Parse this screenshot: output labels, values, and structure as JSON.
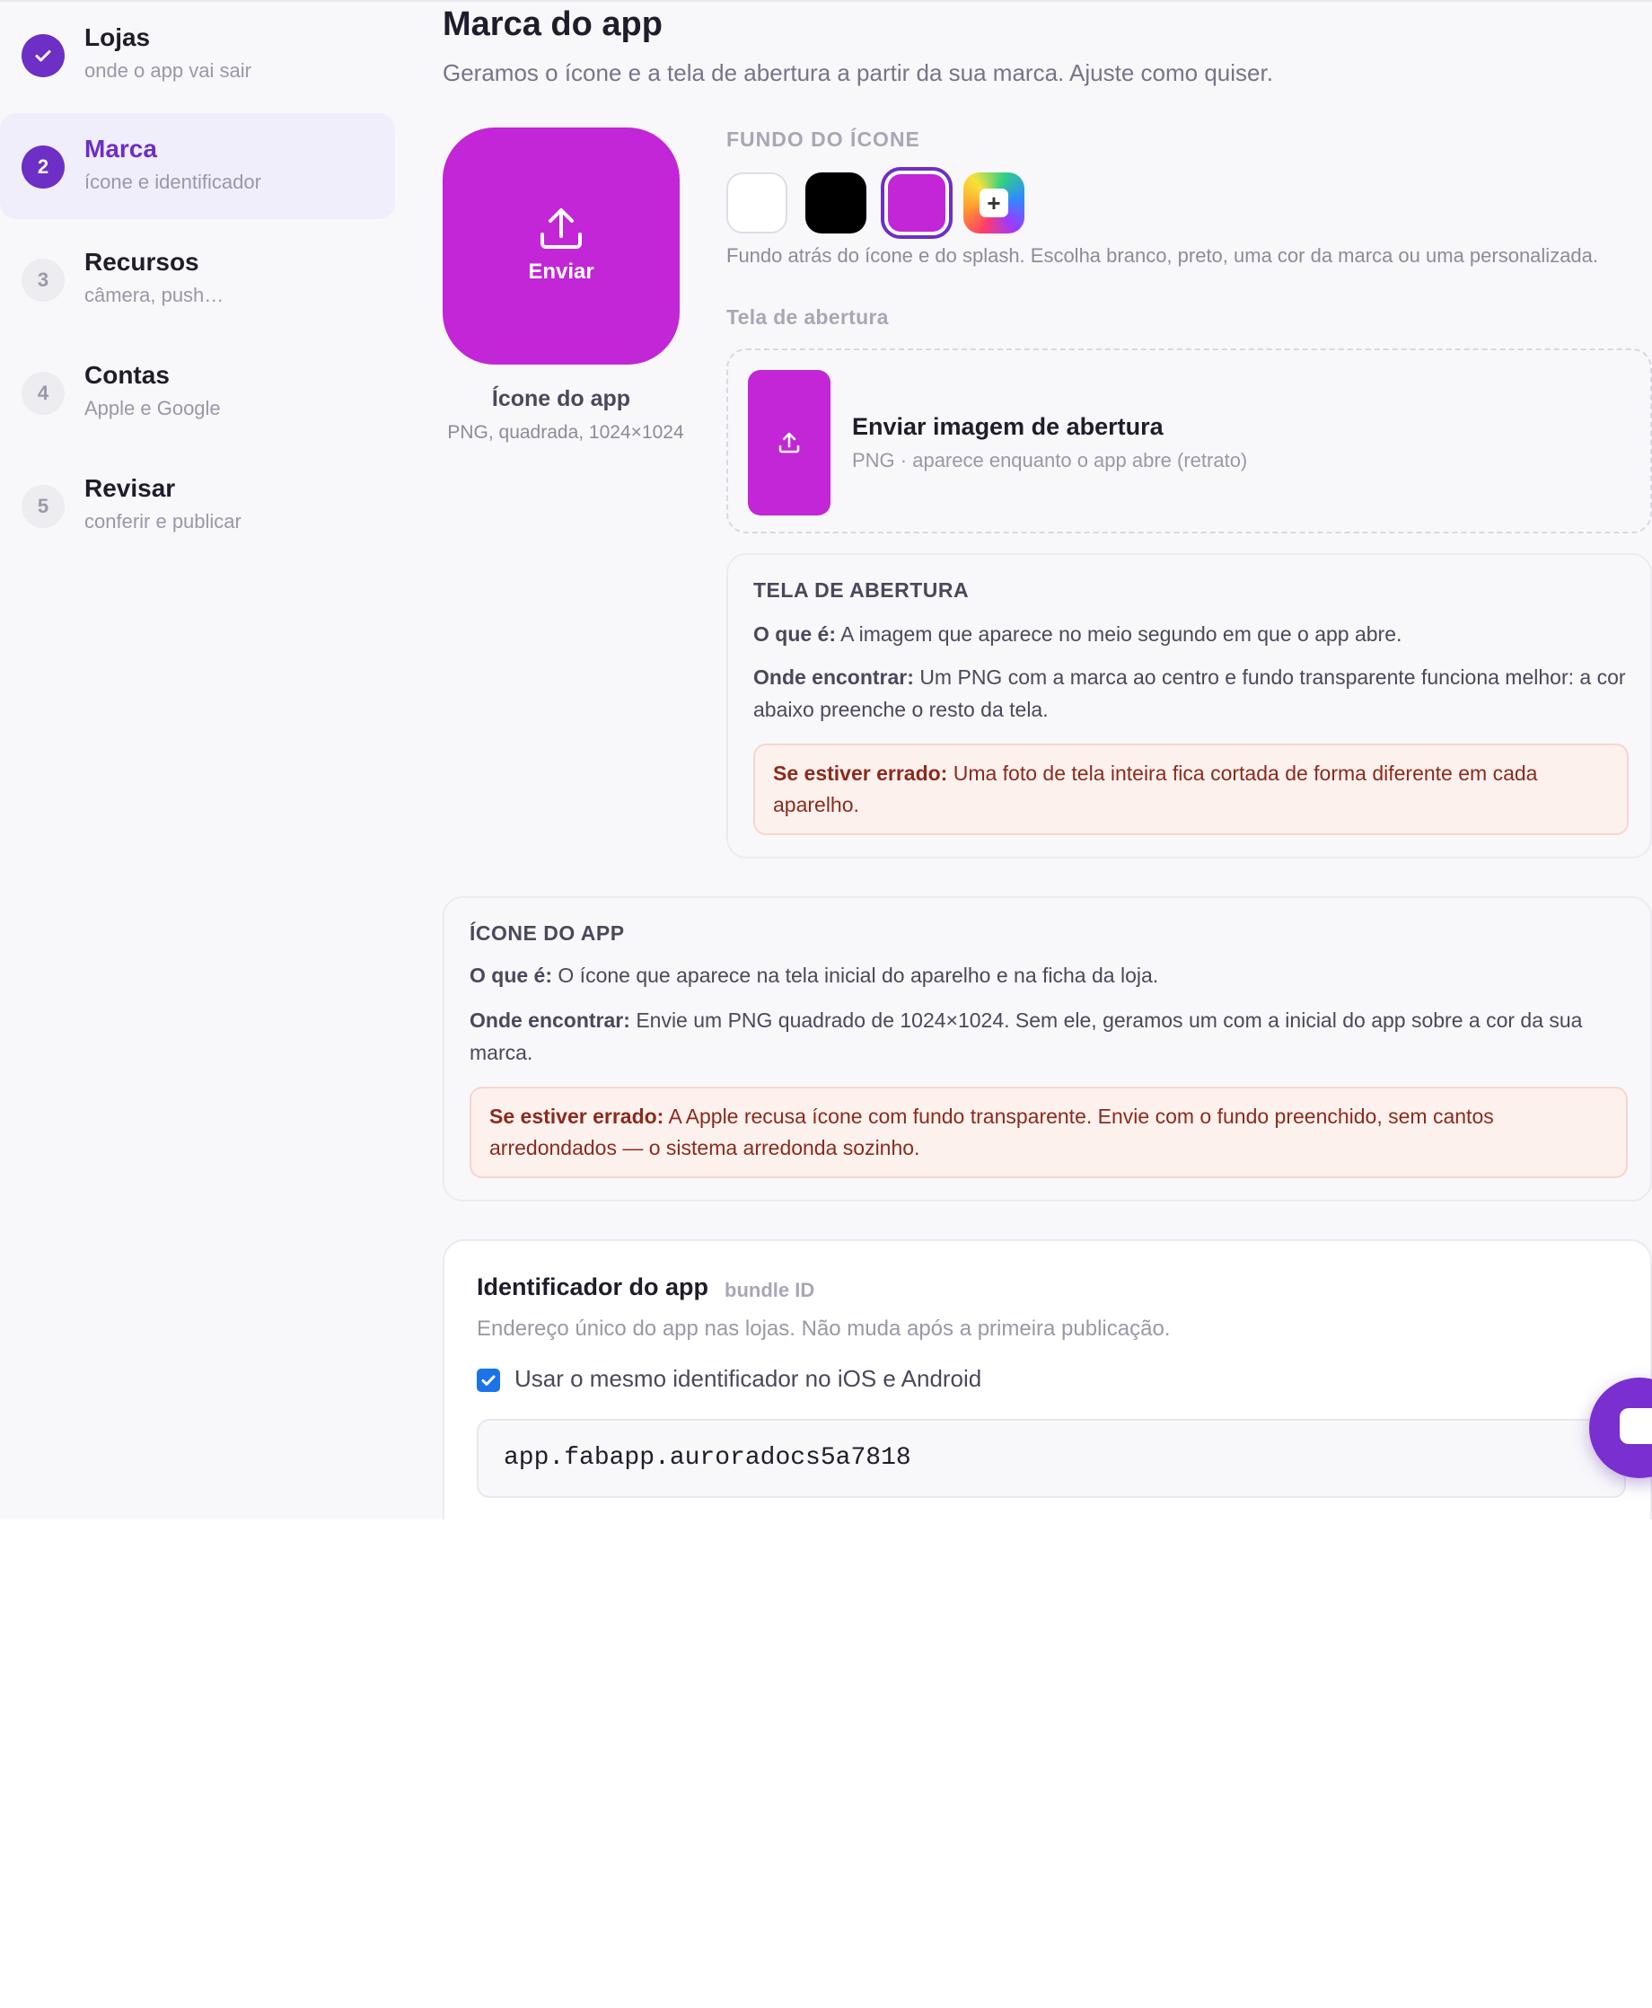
{
  "sidebar": {
    "steps": [
      {
        "number": "",
        "title": "Lojas",
        "subtitle": "onde o app vai sair",
        "state": "done"
      },
      {
        "number": "2",
        "title": "Marca",
        "subtitle": "ícone e identificador",
        "state": "current"
      },
      {
        "number": "3",
        "title": "Recursos",
        "subtitle": "câmera, push…",
        "state": "pending"
      },
      {
        "number": "4",
        "title": "Contas",
        "subtitle": "Apple e Google",
        "state": "pending"
      },
      {
        "number": "5",
        "title": "Revisar",
        "subtitle": "conferir e publicar",
        "state": "pending"
      }
    ]
  },
  "main": {
    "title": "Marca do app",
    "subtitle": "Geramos o ícone e a tela de abertura a partir da sua marca. Ajuste como quiser.",
    "icon_upload": {
      "button_label": "Enviar",
      "caption_title": "Ícone do app",
      "caption_sub": "PNG, quadrada, 1024×1024"
    },
    "icon_background": {
      "label": "FUNDO DO ÍCONE",
      "swatches": [
        {
          "name": "white",
          "color": "#ffffff"
        },
        {
          "name": "black",
          "color": "#000000"
        },
        {
          "name": "brand",
          "color": "#c226d6",
          "selected": true
        },
        {
          "name": "custom",
          "icon": "plus-icon"
        }
      ],
      "help": "Fundo atrás do ícone e do splash. Escolha branco, preto, uma cor da marca ou uma personalizada."
    },
    "splash": {
      "label": "Tela de abertura",
      "upload_title": "Enviar imagem de abertura",
      "upload_sub": "PNG · aparece enquanto o app abre (retrato)"
    },
    "splash_info": {
      "title": "TELA DE ABERTURA",
      "what_label": "O que é:",
      "what_text": "A imagem que aparece no meio segundo em que o app abre.",
      "where_label": "Onde encontrar:",
      "where_text": "Um PNG com a marca ao centro e fundo transparente funciona melhor: a cor abaixo preenche o resto da tela.",
      "wrong_label": "Se estiver errado:",
      "wrong_text": "Uma foto de tela inteira fica cortada de forma diferente em cada aparelho."
    },
    "icon_info": {
      "title": "ÍCONE DO APP",
      "what_label": "O que é:",
      "what_text": "O ícone que aparece na tela inicial do aparelho e na ficha da loja.",
      "where_label": "Onde encontrar:",
      "where_text": "Envie um PNG quadrado de 1024×1024. Sem ele, geramos um com a inicial do app sobre a cor da sua marca.",
      "wrong_label": "Se estiver errado:",
      "wrong_text": "A Apple recusa ícone com fundo transparente. Envie com o fundo preenchido, sem cantos arredondados — o sistema arredonda sozinho."
    },
    "identifier": {
      "title": "Identificador do app",
      "tag": "bundle ID",
      "description": "Endereço único do app nas lojas. Não muda após a primeira publicação.",
      "same_id_label": "Usar o mesmo identificador no iOS e Android",
      "same_id_checked": true,
      "value": "app.fabapp.auroradocs5a7818"
    }
  },
  "colors": {
    "accent": "#6d2fc6",
    "brand": "#c226d6",
    "warning_text": "#8a2b1d",
    "warning_bg": "#fdf1ee"
  }
}
